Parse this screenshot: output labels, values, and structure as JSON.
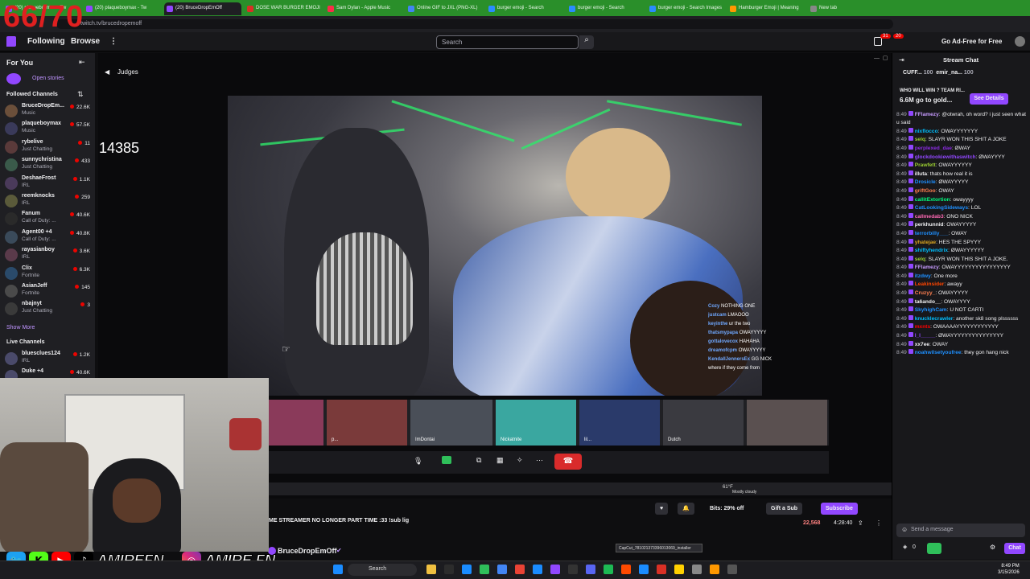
{
  "overlay_counter": "66/70",
  "browser": {
    "tabs": [
      {
        "label": "(20) plaqueboymax - Tw",
        "color": "#9147ff"
      },
      {
        "label": "(20) plaqueboymax - Tw",
        "color": "#9147ff"
      },
      {
        "label": "(20) BruceDropEmOff",
        "color": "#9147ff"
      },
      {
        "label": "DOSE WAR BURGER EMOJI",
        "color": "#d93025"
      },
      {
        "label": "Sam Dylan - Apple Music",
        "color": "#fa2d48"
      },
      {
        "label": "Online GIF to JXL (PNG-XL)",
        "color": "#4285f4"
      },
      {
        "label": "burger emoji - Search",
        "color": "#2a8cff"
      },
      {
        "label": "burger emoji - Search",
        "color": "#2a8cff"
      },
      {
        "label": "burger emoji - Search Images",
        "color": "#2a8cff"
      },
      {
        "label": "Hamburger Emoji | Meaning",
        "color": "#ff9800"
      },
      {
        "label": "New tab",
        "color": "#888888"
      }
    ],
    "url": "twitch.tv/brucedropemoff"
  },
  "topnav": {
    "following": "Following",
    "browse": "Browse",
    "search_placeholder": "Search",
    "notif_count": "31",
    "whisper_count": "20",
    "adfree": "Go Ad-Free for Free"
  },
  "sidebar": {
    "for_you": "For You",
    "open_stories": "Open stories",
    "followed_header": "Followed Channels",
    "channels": [
      {
        "name": "BruceDropEm...",
        "game": "Music",
        "viewers": "22.6K"
      },
      {
        "name": "plaqueboymax",
        "game": "Music",
        "viewers": "57.5K"
      },
      {
        "name": "rybelive",
        "game": "Just Chatting",
        "viewers": "11"
      },
      {
        "name": "sunnychristina",
        "game": "Just Chatting",
        "viewers": "433"
      },
      {
        "name": "DeshaeFrost",
        "game": "IRL",
        "viewers": "1.1K"
      },
      {
        "name": "reemknocks",
        "game": "IRL",
        "viewers": "259"
      },
      {
        "name": "Fanum",
        "game": "Call of Duty: ...",
        "viewers": "40.6K"
      },
      {
        "name": "Agent00 +4",
        "game": "Call of Duty: ...",
        "viewers": "40.8K"
      },
      {
        "name": "rayasianboy",
        "game": "IRL",
        "viewers": "3.6K"
      },
      {
        "name": "Clix",
        "game": "Fortnite",
        "viewers": "6.3K"
      },
      {
        "name": "AsianJeff",
        "game": "Fortnite",
        "viewers": "145"
      },
      {
        "name": "nbajnyt",
        "game": "Just Chatting",
        "viewers": "3"
      }
    ],
    "show_more": "Show More",
    "live_header": "Live Channels",
    "live": [
      {
        "name": "bluesclues124",
        "game": "IRL",
        "viewers": "1.2K"
      },
      {
        "name": "Duke +4",
        "game": "",
        "viewers": "40.6K"
      }
    ]
  },
  "player": {
    "category": "Judges",
    "counter": "14385",
    "tiles": [
      {
        "name": ""
      },
      {
        "name": "p..."
      },
      {
        "name": "ImDontai"
      },
      {
        "name": "Nickatnite"
      },
      {
        "name": "lil..."
      },
      {
        "name": "Dutch"
      },
      {
        "name": ""
      }
    ],
    "overlay_chat": [
      {
        "u": "Cozy",
        "t": "NOTHING ONE"
      },
      {
        "u": "justcam",
        "t": "LMAOOO"
      },
      {
        "u": "keyinthe",
        "t": "ur the two"
      },
      {
        "u": "thatsmypapa",
        "t": "OWAYYYYY"
      },
      {
        "u": "gottalovecox",
        "t": "HAHAHA"
      },
      {
        "u": "dreamofcpm",
        "t": "OWAYYYYY"
      },
      {
        "u": "KendallJennersEx",
        "t": "GG NICK"
      },
      {
        "u": "",
        "t": "where if they come from"
      }
    ],
    "weather": "Mostly cloudy",
    "temp": "61°F"
  },
  "info": {
    "stream_title": "ME STREAMER NO LONGER PART TIME :33 !sub lig",
    "channel_name": "BruceDropEmOff",
    "bits": "Bits: 29% off",
    "gift": "Gift a Sub",
    "subscribe": "Subscribe",
    "viewers": "22,568",
    "uptime": "4:28:40"
  },
  "socials": {
    "handle1": "AMIREFN",
    "handle2": "AMIRE.FN"
  },
  "chat": {
    "header": "Stream Chat",
    "pinned": [
      {
        "name": "CUFF...",
        "count": "100"
      },
      {
        "name": "emir_na...",
        "count": "100"
      }
    ],
    "prediction_q": "WHO WILL WIN ? TEAM RI...",
    "prediction_amt": "6.6M go to gold...",
    "see_details": "See Details",
    "messages": [
      {
        "time": "8:49",
        "user": "FFlamezy",
        "color": "#c79bff",
        "text": "@otwrah, oh word? i just seen what u said"
      },
      {
        "time": "8:49",
        "user": "nixflocco",
        "color": "#00bfff",
        "text": "OWAYYYYYYY"
      },
      {
        "time": "8:49",
        "user": "selq",
        "color": "#9acd32",
        "text": "SLAYR WON THIS SHIT A JOKE"
      },
      {
        "time": "8:49",
        "user": "perplexed_dae",
        "color": "#8a2be2",
        "text": "ØWAY"
      },
      {
        "time": "8:49",
        "user": "glockdookiewithaswitch",
        "color": "#9147ff",
        "text": "ØWAYYYY"
      },
      {
        "time": "8:49",
        "user": "Prawfett",
        "color": "#9acd32",
        "text": "OWAYYYYYY"
      },
      {
        "time": "8:49",
        "user": "illuta",
        "color": "#efeff1",
        "text": "thats how real it is"
      },
      {
        "time": "8:49",
        "user": "Drosicle",
        "color": "#1e90ff",
        "text": "ØWAYYYYY"
      },
      {
        "time": "8:49",
        "user": "griftGoo",
        "color": "#ff7f50",
        "text": "OWAY"
      },
      {
        "time": "8:49",
        "user": "callitExtortion",
        "color": "#00ff7f",
        "text": "owayyyy"
      },
      {
        "time": "8:49",
        "user": "CatLookingSideways",
        "color": "#1e90ff",
        "text": "LOL"
      },
      {
        "time": "8:49",
        "user": "callmedab3",
        "color": "#ff69b4",
        "text": "ONO NICK"
      },
      {
        "time": "8:49",
        "user": "perkhunnid",
        "color": "#efeff1",
        "text": "OWAYYYYY"
      },
      {
        "time": "8:49",
        "user": "terrorbilly___",
        "color": "#1e90ff",
        "text": "OWAY"
      },
      {
        "time": "8:49",
        "user": "yhatejae",
        "color": "#daa520",
        "text": "HES THE SPYYY"
      },
      {
        "time": "8:49",
        "user": "shiftyhendrix",
        "color": "#00bfff",
        "text": "ØWAYYYYYY"
      },
      {
        "time": "8:49",
        "user": "selq",
        "color": "#9acd32",
        "text": "SLAYR WON THIS SHIT A JOKE."
      },
      {
        "time": "8:49",
        "user": "FFlamezy",
        "color": "#c79bff",
        "text": "OWAYYYYYYYYYYYYYYYY"
      },
      {
        "time": "8:49",
        "user": "itzdwy",
        "color": "#1e90ff",
        "text": "One more"
      },
      {
        "time": "8:49",
        "user": "Leakinsider",
        "color": "#ff4500",
        "text": "awayy"
      },
      {
        "time": "8:49",
        "user": "Cruzyy_",
        "color": "#ff7f50",
        "text": "OWAYYYYY"
      },
      {
        "time": "8:49",
        "user": "ta6ando__",
        "color": "#efeff1",
        "text": "OWAYYYY"
      },
      {
        "time": "8:49",
        "user": "SkyhighCam",
        "color": "#1e90ff",
        "text": "U NOT CARTI"
      },
      {
        "time": "8:49",
        "user": "knucklecrawler",
        "color": "#00bfff",
        "text": "another sk8 song plssssss"
      },
      {
        "time": "8:49",
        "user": "mxnts",
        "color": "#ff0000",
        "text": "OWAAAAYYYYYYYYYYYY"
      },
      {
        "time": "8:49",
        "user": "l_l_____",
        "color": "#9147ff",
        "text": "ØWAYYYYYYYYYYYYYYY"
      },
      {
        "time": "8:49",
        "user": "xx7ee",
        "color": "#efeff1",
        "text": "OWAY"
      },
      {
        "time": "8:49",
        "user": "noahwilsetyoufree",
        "color": "#1e90ff",
        "text": "they gon hang nick"
      }
    ],
    "input_placeholder": "Send a message",
    "points": "0",
    "chat_button": "Chat"
  },
  "taskbar": {
    "search": "Search",
    "time": "8:49 PM",
    "date": "3/15/2026",
    "tooltip": "CapCut_781021373396013069_installer"
  }
}
